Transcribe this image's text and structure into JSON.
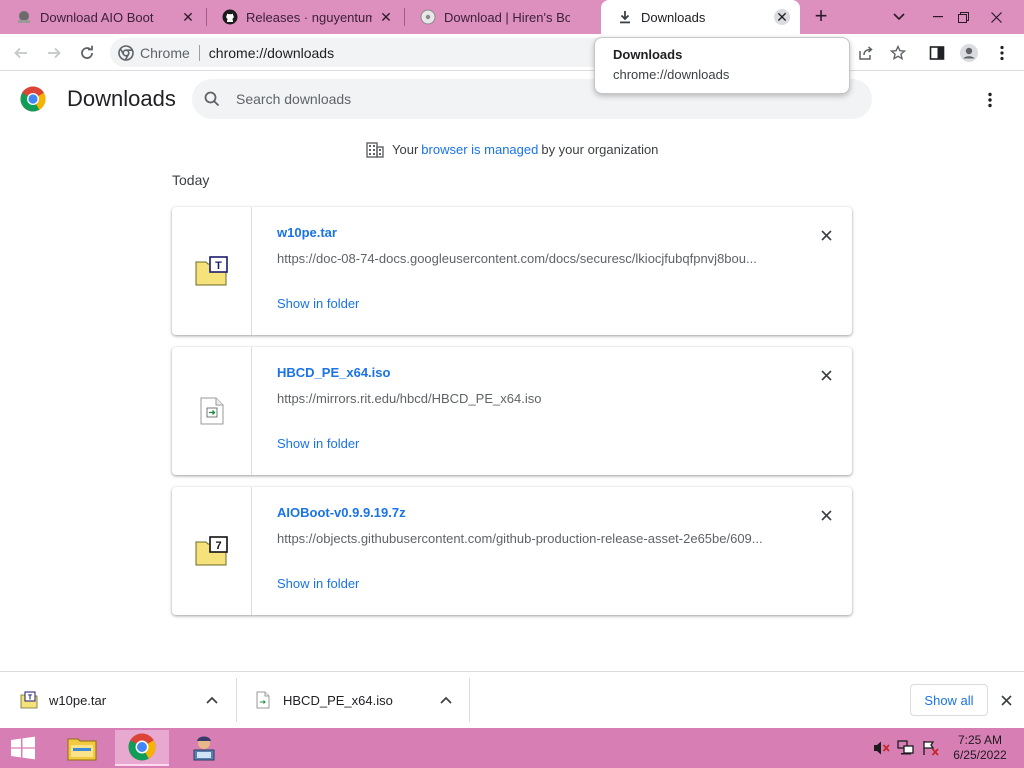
{
  "tabs": [
    {
      "title": "Download AIO Boot",
      "icon": "aio-boot-favicon",
      "active": false
    },
    {
      "title": "Releases · nguyentumine",
      "icon": "github-icon",
      "active": false
    },
    {
      "title": "Download | Hiren's Boot",
      "icon": "hirens-disc-icon",
      "active": false
    },
    {
      "title": "Downloads",
      "icon": "download-icon",
      "active": true
    }
  ],
  "toolbar": {
    "site_chip": "Chrome",
    "url": "chrome://downloads"
  },
  "tooltip": {
    "title": "Downloads",
    "url": "chrome://downloads"
  },
  "page": {
    "title": "Downloads",
    "search_placeholder": "Search downloads",
    "managed": {
      "prefix": "Your",
      "link": "browser is managed",
      "suffix": "by your organization"
    },
    "section": "Today"
  },
  "downloads": [
    {
      "name": "w10pe.tar",
      "url": "https://doc-08-74-docs.googleusercontent.com/docs/securesc/lkiocjfubqfpnvj8bou...",
      "action": "Show in folder",
      "icon": "archive-tar-icon"
    },
    {
      "name": "HBCD_PE_x64.iso",
      "url": "https://mirrors.rit.edu/hbcd/HBCD_PE_x64.iso",
      "action": "Show in folder",
      "icon": "iso-file-icon"
    },
    {
      "name": "AIOBoot-v0.9.9.19.7z",
      "url": "https://objects.githubusercontent.com/github-production-release-asset-2e65be/609...",
      "action": "Show in folder",
      "icon": "archive-7z-icon"
    }
  ],
  "shelf": {
    "items": [
      {
        "name": "w10pe.tar"
      },
      {
        "name": "HBCD_PE_x64.iso"
      }
    ],
    "show_all": "Show all"
  },
  "taskbar": {
    "time": "7:25 AM",
    "date": "6/25/2022"
  },
  "colors": {
    "tabstrip": "#dd8fbe",
    "taskbar": "#d77fb5",
    "link": "#1a73e8"
  }
}
